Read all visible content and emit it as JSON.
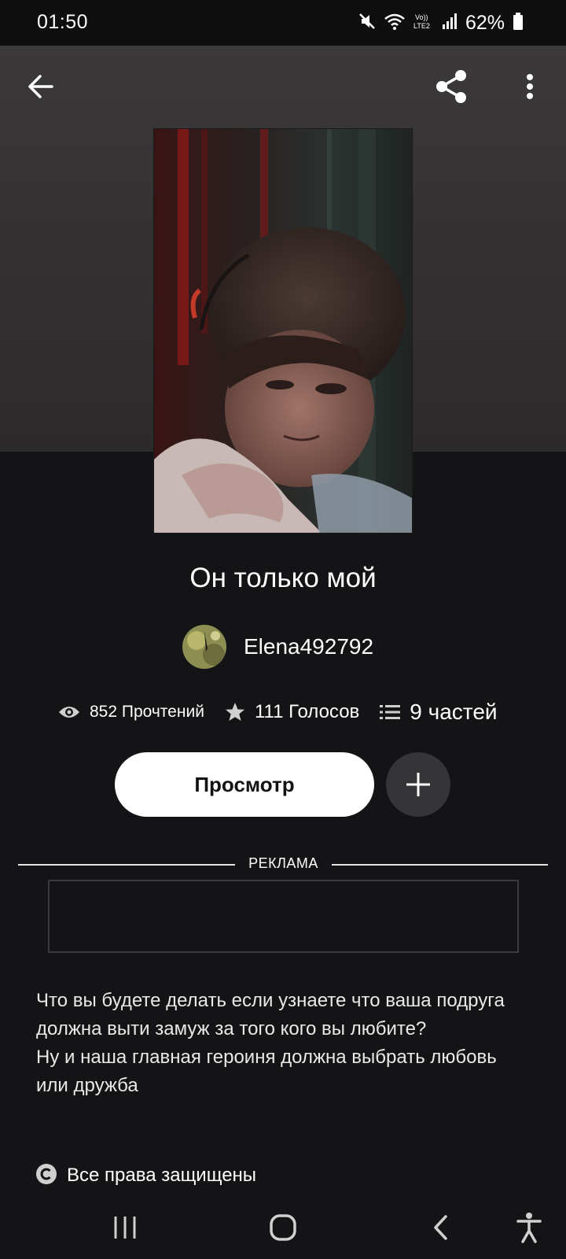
{
  "status_bar": {
    "time": "01:50",
    "battery": "62%",
    "icons": [
      "mute-icon",
      "wifi-icon",
      "volte-icon",
      "signal-icon",
      "battery-icon"
    ]
  },
  "toolbar": {
    "back_icon": "arrow-left-icon",
    "share_icon": "share-icon",
    "more_icon": "more-vertical-icon"
  },
  "story": {
    "title": "Он только мой",
    "author": "Elena492792",
    "stats": {
      "reads": "852 Прочтений",
      "votes": "111 Голосов",
      "parts": "9 частей"
    },
    "view_button": "Просмотр",
    "description": "Что вы будете делать если узнаете что ваша подруга должна выти замуж за того кого вы любите?\nНу и наша главная героиня должна выбрать любовь или дружба",
    "copyright": "Все права защищены"
  },
  "ad": {
    "label": "РЕКЛАМА"
  },
  "nav_bar": {
    "icons": [
      "recents-icon",
      "home-icon",
      "back-icon",
      "accessibility-icon"
    ]
  },
  "colors": {
    "background": "#141316",
    "header": "#333132",
    "button": "#ffffff",
    "add_button": "#353437"
  }
}
